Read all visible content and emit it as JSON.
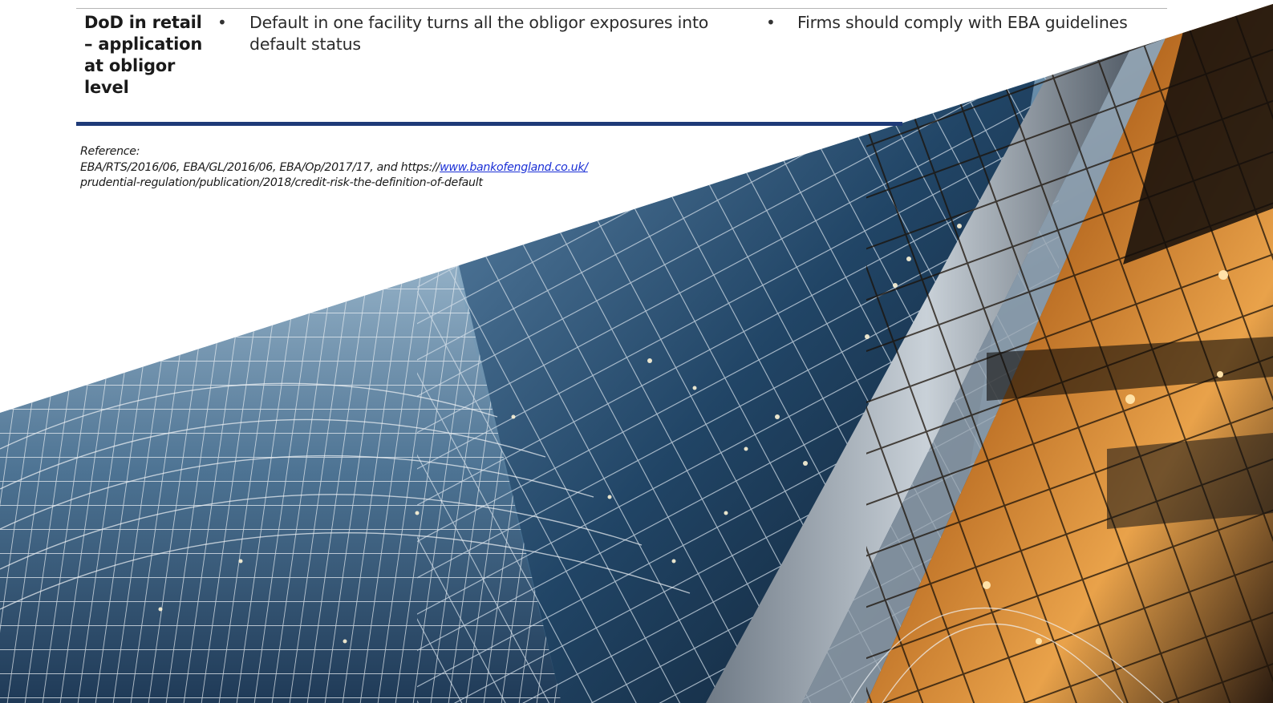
{
  "table": {
    "row_header": "DoD in retail – application at obligor level",
    "cells": [
      {
        "bullet": "•",
        "text": "Default in one facility turns all the obligor exposures into default status"
      },
      {
        "bullet": "•",
        "text": "Firms should comply with EBA guidelines"
      }
    ]
  },
  "reference": {
    "label": "Reference:",
    "line1_text": "EBA/RTS/2016/06,  EBA/GL/2016/06, EBA/Op/2017/17, and https://",
    "line1_link": "www.bankofengland.co.uk/",
    "line2_text": "prudential-regulation/publication/2018/credit-risk-the-definition-of-default"
  },
  "colors": {
    "accent_rule": "#1e3a78",
    "link": "#1a2fd6"
  },
  "image": {
    "description_icon": "building-photo"
  }
}
